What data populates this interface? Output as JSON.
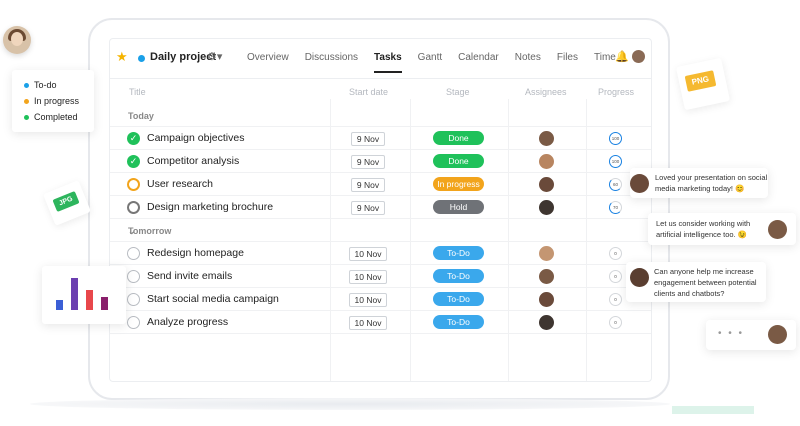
{
  "app": {
    "project_name": "Daily project",
    "tabs": [
      {
        "label": "Overview"
      },
      {
        "label": "Discussions"
      },
      {
        "label": "Tasks",
        "active": true
      },
      {
        "label": "Gantt"
      },
      {
        "label": "Calendar"
      },
      {
        "label": "Notes"
      },
      {
        "label": "Files"
      },
      {
        "label": "Time"
      }
    ]
  },
  "columns": {
    "title": "Title",
    "start_date": "Start date",
    "stage": "Stage",
    "assignees": "Assignees",
    "progress": "Progress"
  },
  "sections": {
    "today": "Today",
    "tomorrow": "Tomorrow"
  },
  "tasks": [
    {
      "name": "Campaign objectives",
      "date": "9 Nov",
      "stage": "Done",
      "progress": "100"
    },
    {
      "name": "Competitor analysis",
      "date": "9 Nov",
      "stage": "Done",
      "progress": "100"
    },
    {
      "name": "User research",
      "date": "9 Nov",
      "stage": "In progress",
      "progress": "60"
    },
    {
      "name": "Design marketing brochure",
      "date": "9 Nov",
      "stage": "Hold",
      "progress": "70"
    },
    {
      "name": "Redesign homepage",
      "date": "10 Nov",
      "stage": "To-Do",
      "progress": "0"
    },
    {
      "name": "Send invite emails",
      "date": "10 Nov",
      "stage": "To-Do",
      "progress": "0"
    },
    {
      "name": "Start social media campaign",
      "date": "10 Nov",
      "stage": "To-Do",
      "progress": "0"
    },
    {
      "name": "Analyze progress",
      "date": "10 Nov",
      "stage": "To-Do",
      "progress": "0"
    }
  ],
  "legend": [
    {
      "label": "To-do",
      "color": "#1aa0e8"
    },
    {
      "label": "In progress",
      "color": "#f2a41c"
    },
    {
      "label": "Completed",
      "color": "#1fc15a"
    }
  ],
  "file_tags": {
    "png": "PNG",
    "jpg": "JPG"
  },
  "chat": [
    {
      "text_1": "Loved your presentation on social",
      "text_2": "media marketing today! 😊"
    },
    {
      "text_1": "Let us consider working with",
      "text_2": "artificial intelligence too. 😉"
    },
    {
      "text_1": "Can anyone help me increase",
      "text_2": "engagement between potential",
      "text_3": "clients and chatbots?"
    }
  ],
  "typing_indicator": "• • •",
  "colors": {
    "done": "#1fc15a",
    "in_progress": "#f2a41c",
    "hold": "#6f7277",
    "todo": "#3aa8ec",
    "accent": "#1a82e2"
  },
  "icons": {
    "star": "star-icon",
    "gear": "gear-icon",
    "bell": "bell-icon",
    "chevron": "chevron-down-icon",
    "check": "check-icon"
  }
}
